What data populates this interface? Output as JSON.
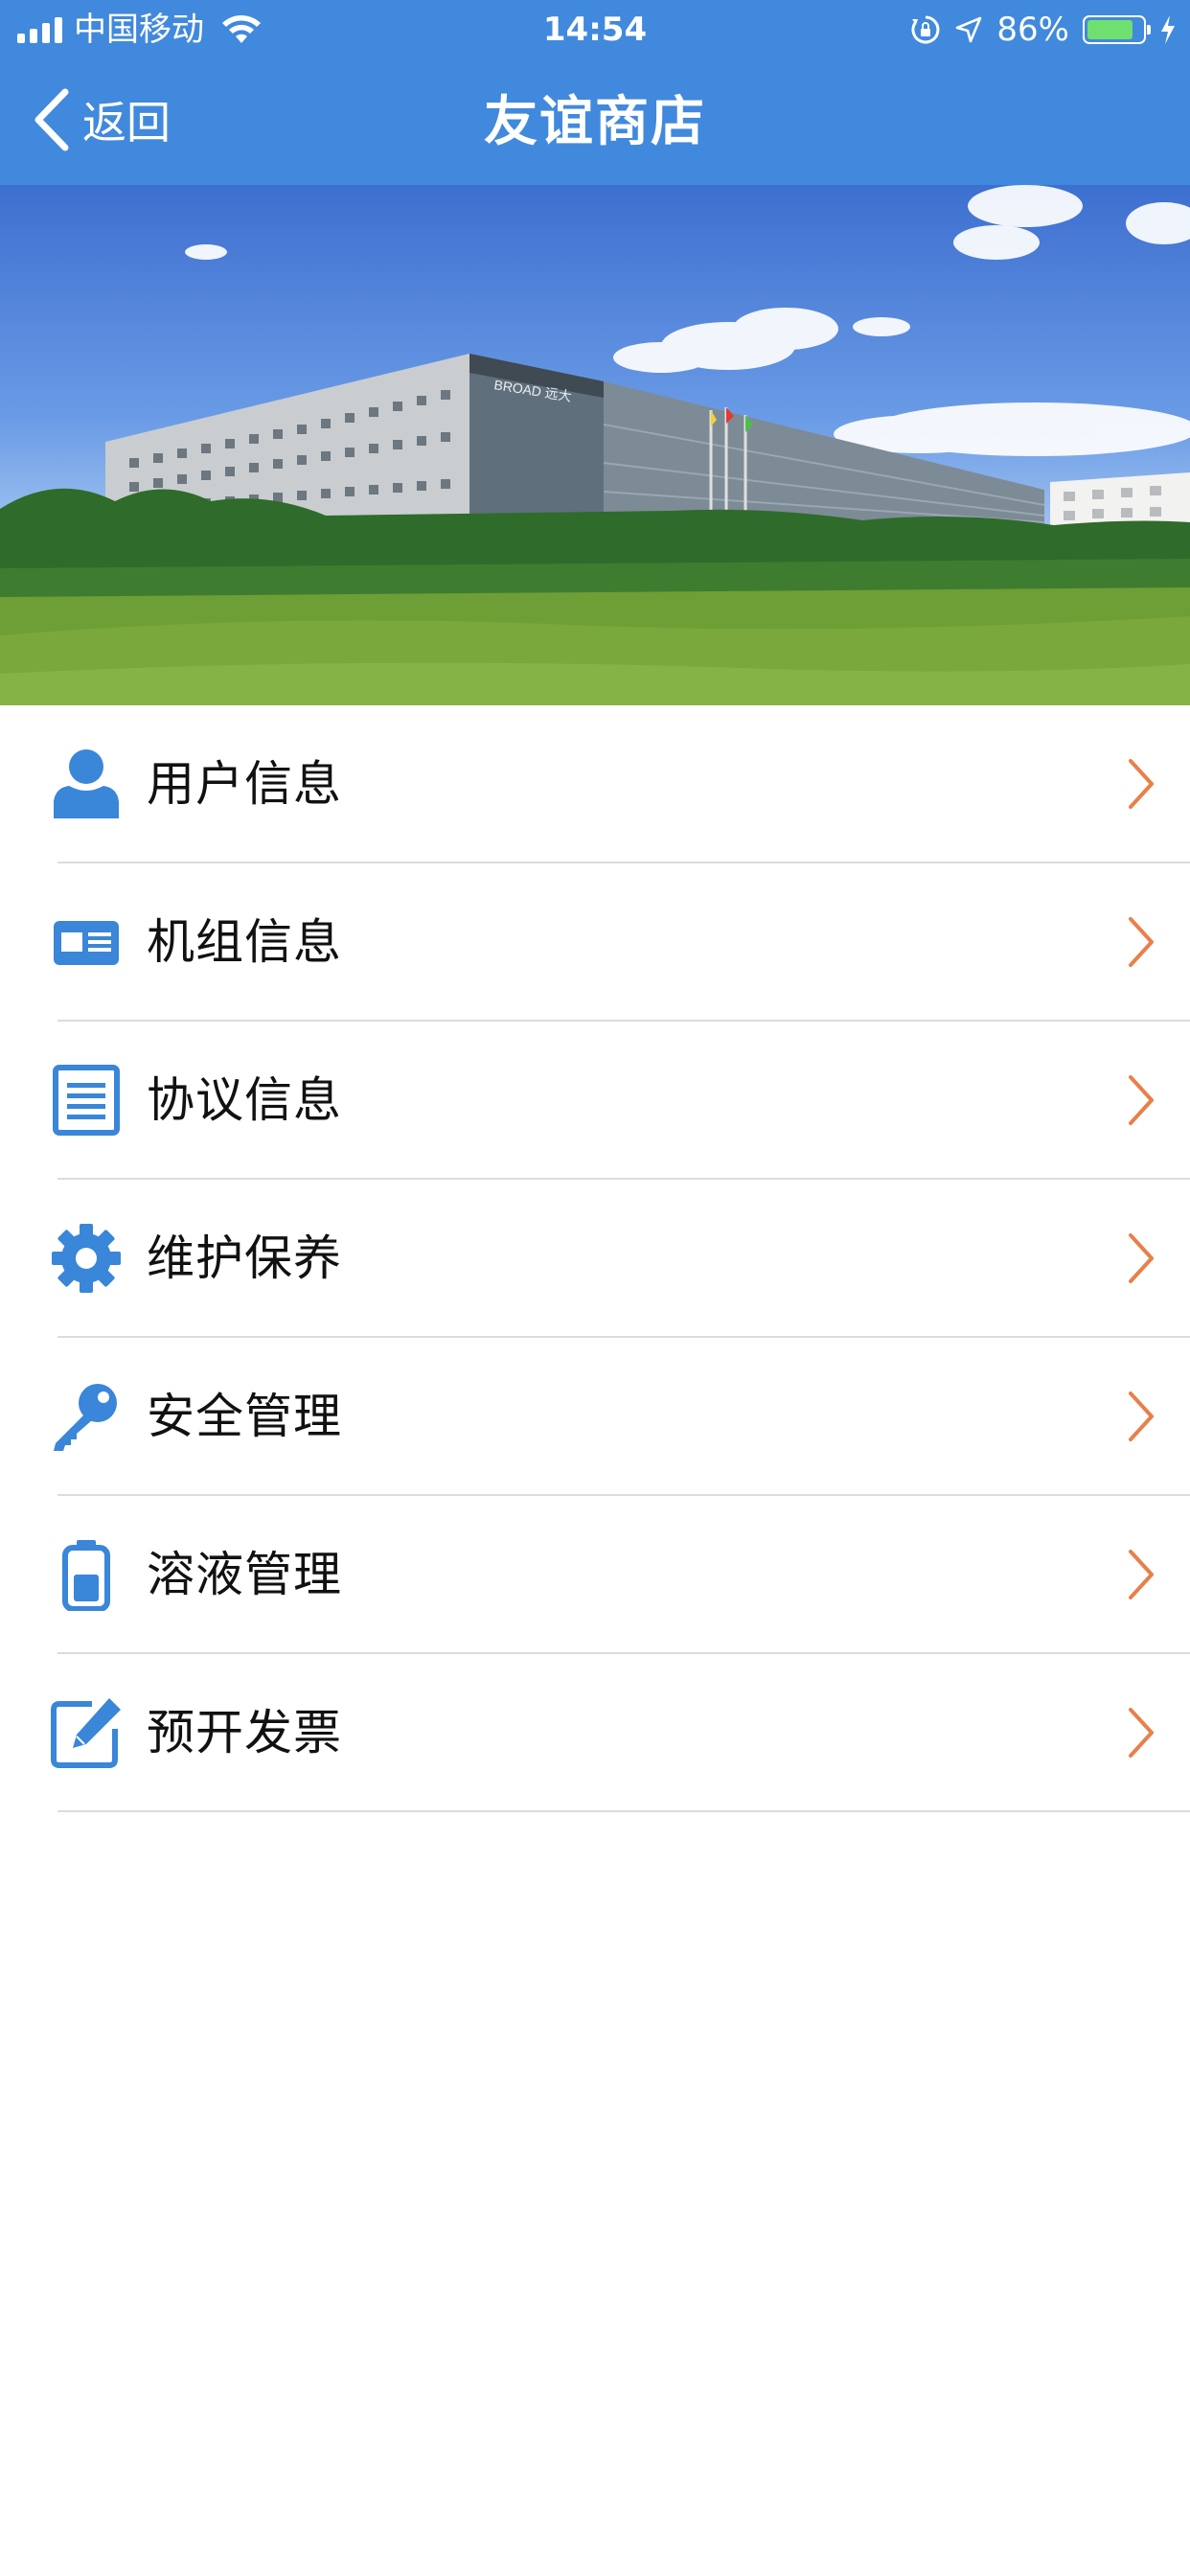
{
  "status_bar": {
    "carrier": "中国移动",
    "time": "14:54",
    "battery_percent": "86%",
    "battery_level": 0.86,
    "icons": [
      "signal-icon",
      "wifi-icon",
      "orientation-lock-icon",
      "location-icon",
      "battery-icon",
      "charging-icon"
    ]
  },
  "nav": {
    "back_label": "返回",
    "title": "友谊商店"
  },
  "hero": {
    "building_sign": "BROAD 远大"
  },
  "menu": {
    "items": [
      {
        "label": "用户信息",
        "icon": "user-icon"
      },
      {
        "label": "机组信息",
        "icon": "id-card-icon"
      },
      {
        "label": "协议信息",
        "icon": "document-icon"
      },
      {
        "label": "维护保养",
        "icon": "gear-icon"
      },
      {
        "label": "安全管理",
        "icon": "key-icon"
      },
      {
        "label": "溶液管理",
        "icon": "battery-container-icon"
      },
      {
        "label": "预开发票",
        "icon": "edit-icon"
      }
    ]
  },
  "colors": {
    "header_blue": "#4189dd",
    "icon_blue": "#3a86d8",
    "chevron_orange": "#e8804a",
    "divider": "#dcdcdc"
  }
}
